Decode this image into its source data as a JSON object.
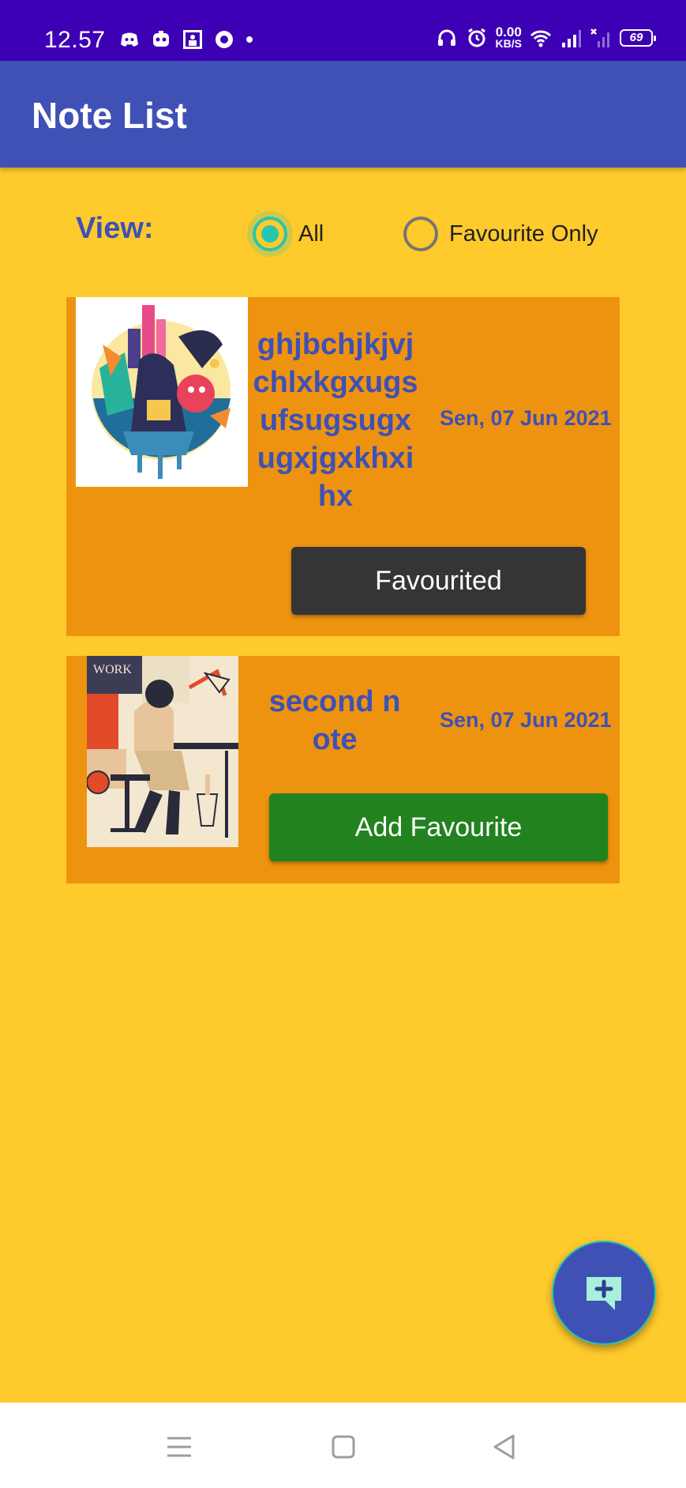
{
  "status_bar": {
    "time": "12.57",
    "net_speed_value": "0.00",
    "net_speed_unit": "KB/S",
    "battery": "69"
  },
  "app_bar": {
    "title": "Note List"
  },
  "view_filter": {
    "label": "View:",
    "options": [
      {
        "label": "All",
        "selected": true
      },
      {
        "label": "Favourite Only",
        "selected": false
      }
    ]
  },
  "notes": [
    {
      "title": "ghjbchjkjvjchlxkgxugsufsugsugxugxjgxkhxihx",
      "date": "Sen, 07 Jun 2021",
      "button_label": "Favourited",
      "favourited": true,
      "image_icon": "abstract-city-illustration"
    },
    {
      "title": "second note",
      "date": "Sen, 07 Jun 2021",
      "button_label": "Add Favourite",
      "favourited": false,
      "image_icon": "work-desk-illustration"
    }
  ],
  "fab": {
    "icon": "add-note-icon"
  },
  "nav_bar": {
    "icons": [
      "menu-icon",
      "home-icon",
      "back-icon"
    ]
  },
  "colors": {
    "status_bar": "#3e00b4",
    "app_bar": "#3f51b5",
    "background": "#ffca2c",
    "card": "#ee930f",
    "favourited_button": "#353535",
    "add_favourite_button": "#21821f",
    "accent": "#26c6b0"
  }
}
